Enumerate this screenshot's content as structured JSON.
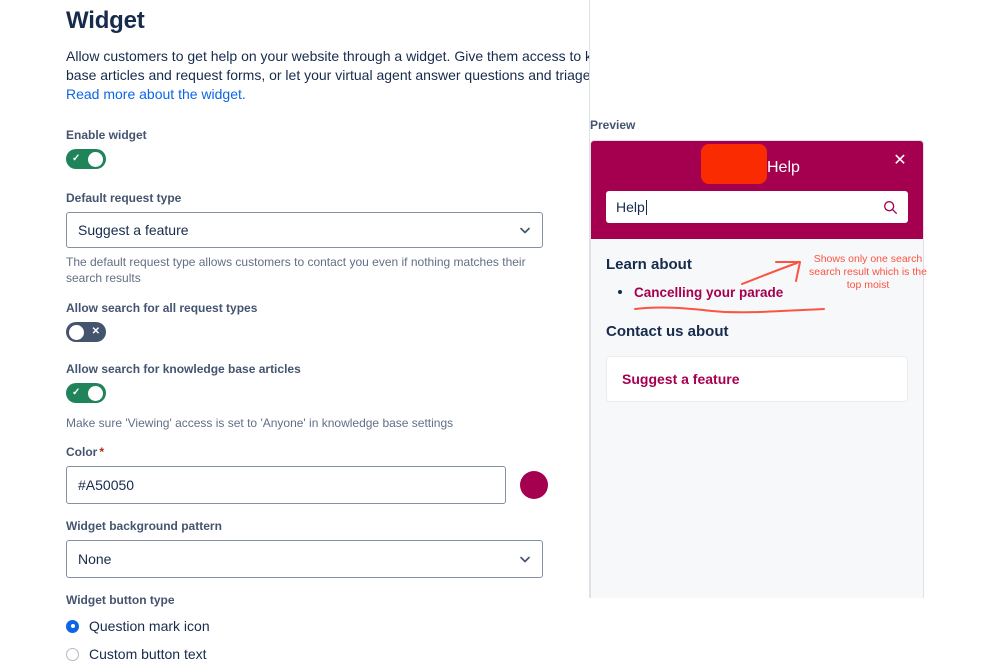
{
  "header": {
    "title": "Widget",
    "description_part1": "Allow customers to get help on your website through a widget. Give them access to knowledge base articles and request forms, or let your virtual agent answer questions and triage requests. ",
    "link_text": "Read more about the widget."
  },
  "settings": {
    "enable_widget": {
      "label": "Enable widget",
      "state": "on",
      "glyph": "✓"
    },
    "default_request_type": {
      "label": "Default request type",
      "value": "Suggest a feature",
      "help": "The default request type allows customers to contact you even if nothing matches their search results"
    },
    "allow_search_all_request_types": {
      "label": "Allow search for all request types",
      "state": "off",
      "glyph": "✕"
    },
    "allow_search_kb_articles": {
      "label": "Allow search for knowledge base articles",
      "state": "on",
      "glyph": "✓",
      "help": "Make sure 'Viewing' access is set to 'Anyone' in knowledge base settings"
    },
    "color": {
      "label": "Color",
      "required_marker": "*",
      "value": "#A50050",
      "swatch_hex": "#A50050"
    },
    "background_pattern": {
      "label": "Widget background pattern",
      "value": "None"
    },
    "button_type": {
      "label": "Widget button type",
      "options": [
        {
          "label": "Question mark icon",
          "selected": true
        },
        {
          "label": "Custom button text",
          "selected": false
        }
      ]
    }
  },
  "preview": {
    "label": "Preview",
    "widget": {
      "header_title": "Help",
      "header_bg_hex": "#A50050",
      "logo_placeholder_hex": "#FA2B00",
      "close_icon": "✕",
      "search": {
        "value": "Help",
        "icon": "search-icon"
      },
      "learn_section_title": "Learn about",
      "results": [
        "Cancelling your parade"
      ],
      "contact_section_title": "Contact us about",
      "contact_options": [
        "Suggest a feature"
      ]
    }
  },
  "annotation": {
    "text": "Shows only one search search result which is the top moist",
    "color_hex": "#FB5441"
  }
}
